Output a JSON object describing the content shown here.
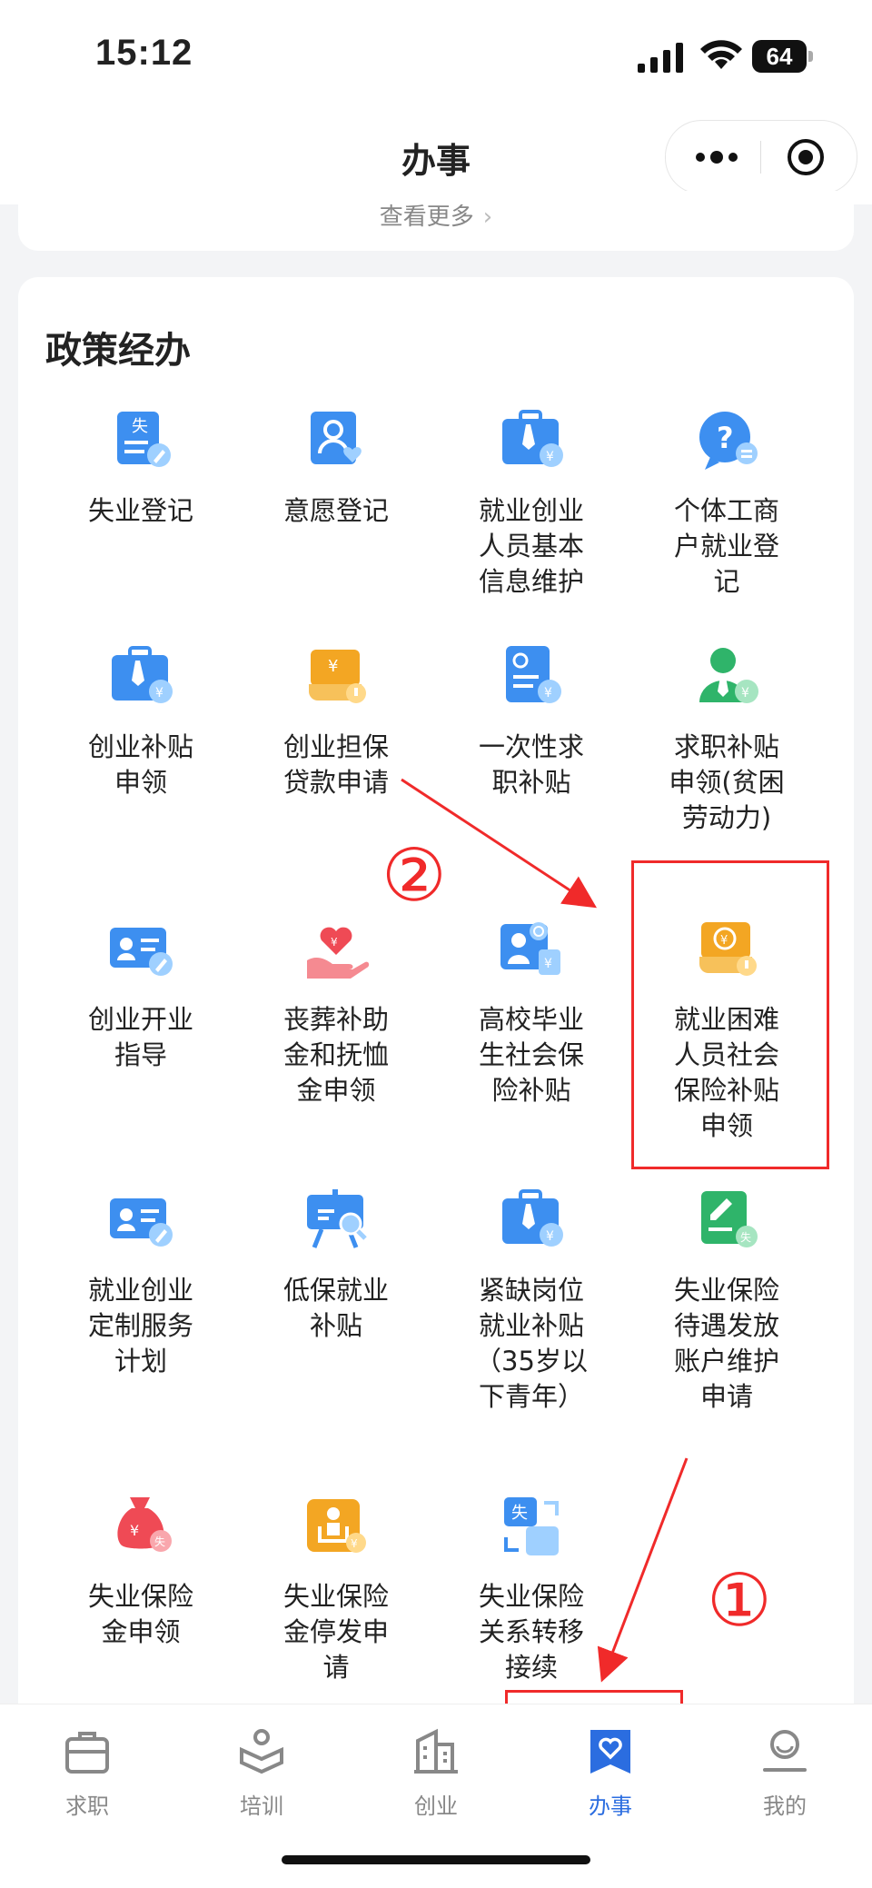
{
  "status_bar": {
    "time": "15:12",
    "battery": "64"
  },
  "nav": {
    "title": "办事"
  },
  "prev_card": {
    "see_more": "查看更多"
  },
  "policy": {
    "title": "政策经办",
    "items": [
      {
        "label": "失业登记",
        "icon": "unemployment-register-icon"
      },
      {
        "label": "意愿登记",
        "icon": "intent-register-icon"
      },
      {
        "label": "就业创业人员基本信息维护",
        "icon": "briefcase-yuan-icon"
      },
      {
        "label": "个体工商户就业登记",
        "icon": "question-chat-icon"
      },
      {
        "label": "创业补贴申领",
        "icon": "briefcase-yuan-icon"
      },
      {
        "label": "创业担保贷款申请",
        "icon": "loan-guarantee-icon"
      },
      {
        "label": "一次性求职补贴",
        "icon": "document-yuan-icon"
      },
      {
        "label": "求职补贴申领(贫困劳动力)",
        "icon": "person-yuan-icon"
      },
      {
        "label": "创业开业指导",
        "icon": "id-card-edit-icon"
      },
      {
        "label": "丧葬补助金和抚恤金申领",
        "icon": "heart-hand-icon"
      },
      {
        "label": "高校毕业生社会保险补贴",
        "icon": "graduate-insurance-icon"
      },
      {
        "label": "就业困难人员社会保险补贴申领",
        "icon": "insurance-subsidy-icon"
      },
      {
        "label": "就业创业定制服务计划",
        "icon": "id-card-edit-icon"
      },
      {
        "label": "低保就业补贴",
        "icon": "presentation-search-icon"
      },
      {
        "label": "紧缺岗位就业补贴（35岁以下青年）",
        "icon": "briefcase-yuan-icon"
      },
      {
        "label": "失业保险待遇发放账户维护申请",
        "icon": "edit-document-icon"
      },
      {
        "label": "失业保险金申领",
        "icon": "money-bag-icon"
      },
      {
        "label": "失业保险金停发申请",
        "icon": "person-stop-icon"
      },
      {
        "label": "失业保险关系转移接续",
        "icon": "transfer-icon"
      }
    ]
  },
  "annotations": {
    "step1": "①",
    "step2": "②"
  },
  "tabs": [
    {
      "label": "求职",
      "icon": "briefcase-icon"
    },
    {
      "label": "培训",
      "icon": "training-icon"
    },
    {
      "label": "创业",
      "icon": "building-icon"
    },
    {
      "label": "办事",
      "icon": "heart-flag-icon"
    },
    {
      "label": "我的",
      "icon": "profile-icon"
    }
  ],
  "colors": {
    "accent": "#2b6de0",
    "icon_blue": "#3d8ff0",
    "icon_orange": "#f3a623",
    "icon_green": "#2fb46a",
    "icon_red": "#ef4a55",
    "annotation_red": "#f02a2a"
  }
}
